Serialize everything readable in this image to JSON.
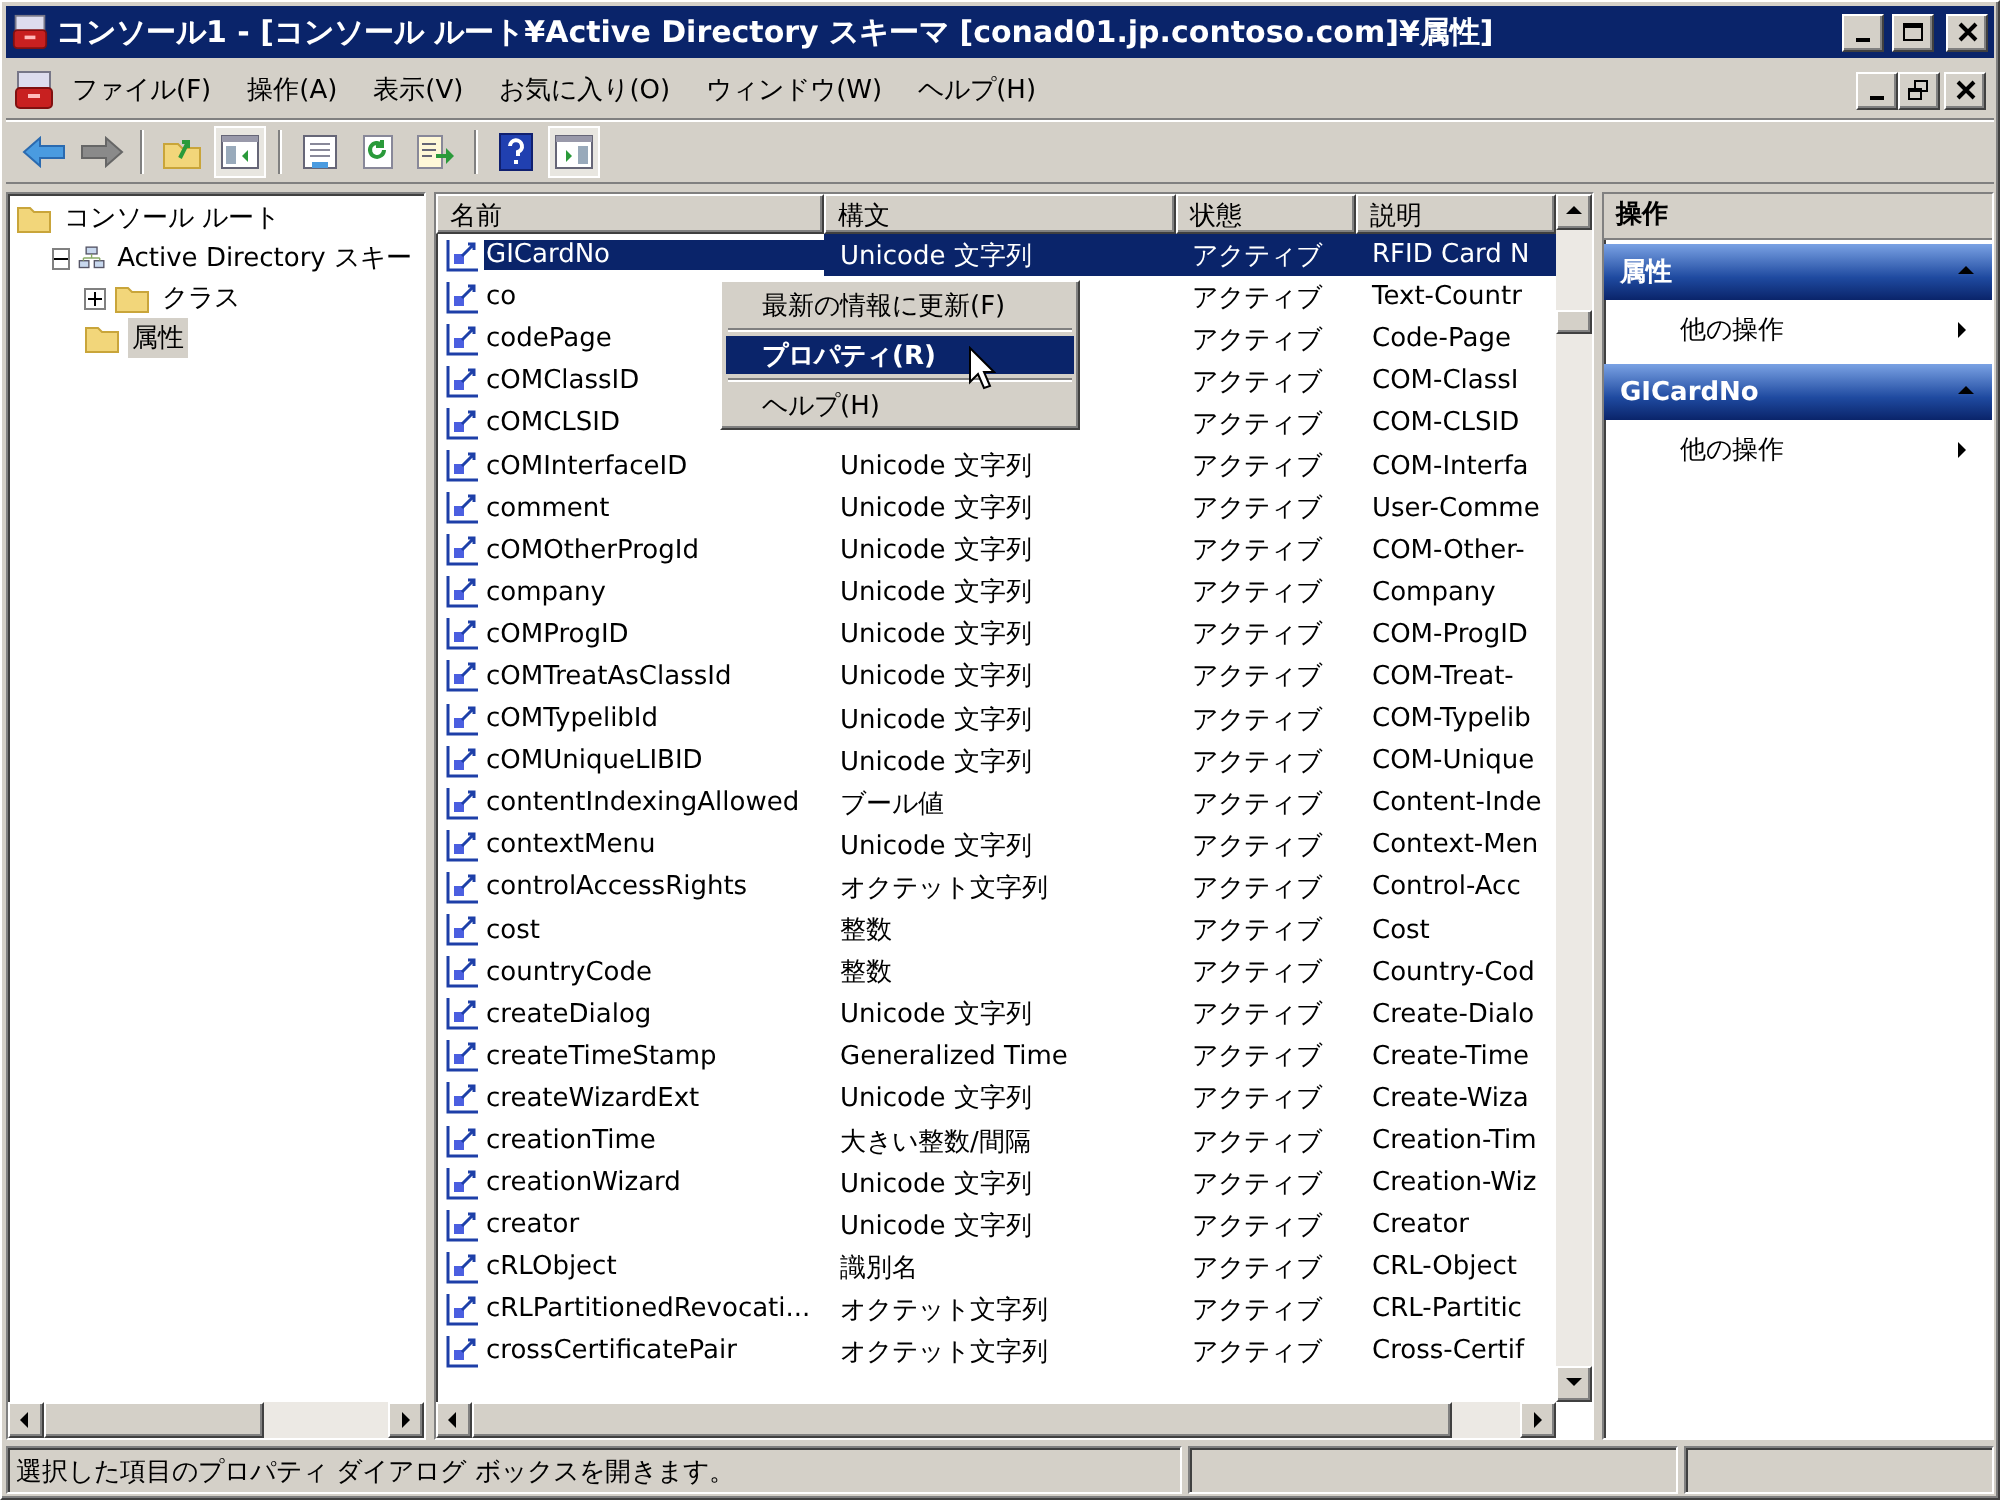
{
  "window": {
    "title": "コンソール1 - [コンソール ルート¥Active Directory スキーマ [conad01.jp.contoso.com]¥属性]"
  },
  "menu_bar": [
    "ファイル(F)",
    "操作(A)",
    "表示(V)",
    "お気に入り(O)",
    "ウィンドウ(W)",
    "ヘルプ(H)"
  ],
  "toolbar": [
    {
      "kind": "back",
      "pressed": false
    },
    {
      "kind": "forward",
      "pressed": false
    },
    {
      "kind": "separator"
    },
    {
      "kind": "up",
      "pressed": false
    },
    {
      "kind": "tree",
      "pressed": true
    },
    {
      "kind": "separator"
    },
    {
      "kind": "properties",
      "pressed": false
    },
    {
      "kind": "refresh",
      "pressed": false
    },
    {
      "kind": "export",
      "pressed": false
    },
    {
      "kind": "separator"
    },
    {
      "kind": "help",
      "pressed": false
    },
    {
      "kind": "actionpane",
      "pressed": true
    }
  ],
  "tree": [
    {
      "label": "コンソール ルート",
      "kind": "folder",
      "selected": false,
      "children": [
        {
          "label": "Active Directory スキー",
          "kind": "directory",
          "selected": false,
          "expanded": true,
          "children": [
            {
              "label": "クラス",
              "kind": "folder",
              "selected": false,
              "expanded": false
            },
            {
              "label": "属性",
              "kind": "folder",
              "selected": true
            }
          ]
        }
      ]
    }
  ],
  "table": {
    "columns": [
      "名前",
      "構文",
      "状態",
      "説明"
    ],
    "rows": [
      {
        "name": "GICardNo",
        "syntax": "Unicode 文字列",
        "status": "アクティブ",
        "description": "RFID Card N",
        "selected": true
      },
      {
        "name": "co",
        "status": "アクティブ",
        "description": "Text-Countr",
        "selected": false
      },
      {
        "name": "codePage",
        "status": "アクティブ",
        "description": "Code-Page",
        "selected": false
      },
      {
        "name": "cOMClassID",
        "status": "アクティブ",
        "description": "COM-ClassI",
        "selected": false
      },
      {
        "name": "cOMCLSID",
        "status": "アクティブ",
        "description": "COM-CLSID",
        "selected": false
      },
      {
        "name": "cOMInterfaceID",
        "syntax": "Unicode 文字列",
        "status": "アクティブ",
        "description": "COM-Interfa",
        "selected": false
      },
      {
        "name": "comment",
        "syntax": "Unicode 文字列",
        "status": "アクティブ",
        "description": "User-Comme",
        "selected": false
      },
      {
        "name": "cOMOtherProgId",
        "syntax": "Unicode 文字列",
        "status": "アクティブ",
        "description": "COM-Other-",
        "selected": false
      },
      {
        "name": "company",
        "syntax": "Unicode 文字列",
        "status": "アクティブ",
        "description": "Company",
        "selected": false
      },
      {
        "name": "cOMProgID",
        "syntax": "Unicode 文字列",
        "status": "アクティブ",
        "description": "COM-ProgID",
        "selected": false
      },
      {
        "name": "cOMTreatAsClassId",
        "syntax": "Unicode 文字列",
        "status": "アクティブ",
        "description": "COM-Treat-",
        "selected": false
      },
      {
        "name": "cOMTypelibId",
        "syntax": "Unicode 文字列",
        "status": "アクティブ",
        "description": "COM-Typelib",
        "selected": false
      },
      {
        "name": "cOMUniqueLIBID",
        "syntax": "Unicode 文字列",
        "status": "アクティブ",
        "description": "COM-Unique",
        "selected": false
      },
      {
        "name": "contentIndexingAllowed",
        "syntax": "ブール値",
        "status": "アクティブ",
        "description": "Content-Inde",
        "selected": false
      },
      {
        "name": "contextMenu",
        "syntax": "Unicode 文字列",
        "status": "アクティブ",
        "description": "Context-Men",
        "selected": false
      },
      {
        "name": "controlAccessRights",
        "syntax": "オクテット文字列",
        "status": "アクティブ",
        "description": "Control-Acc",
        "selected": false
      },
      {
        "name": "cost",
        "syntax": "整数",
        "status": "アクティブ",
        "description": "Cost",
        "selected": false
      },
      {
        "name": "countryCode",
        "syntax": "整数",
        "status": "アクティブ",
        "description": "Country-Cod",
        "selected": false
      },
      {
        "name": "createDialog",
        "syntax": "Unicode 文字列",
        "status": "アクティブ",
        "description": "Create-Dialo",
        "selected": false
      },
      {
        "name": "createTimeStamp",
        "syntax": "Generalized Time",
        "status": "アクティブ",
        "description": "Create-Time",
        "selected": false
      },
      {
        "name": "createWizardExt",
        "syntax": "Unicode 文字列",
        "status": "アクティブ",
        "description": "Create-Wiza",
        "selected": false
      },
      {
        "name": "creationTime",
        "syntax": "大きい整数/間隔",
        "status": "アクティブ",
        "description": "Creation-Tim",
        "selected": false
      },
      {
        "name": "creationWizard",
        "syntax": "Unicode 文字列",
        "status": "アクティブ",
        "description": "Creation-Wiz",
        "selected": false
      },
      {
        "name": "creator",
        "syntax": "Unicode 文字列",
        "status": "アクティブ",
        "description": "Creator",
        "selected": false
      },
      {
        "name": "cRLObject",
        "syntax": "識別名",
        "status": "アクティブ",
        "description": "CRL-Object",
        "selected": false
      },
      {
        "name": "cRLPartitionedRevocati...",
        "syntax": "オクテット文字列",
        "status": "アクティブ",
        "description": "CRL-Partitic",
        "selected": false
      },
      {
        "name": "crossCertificatePair",
        "syntax": "オクテット文字列",
        "status": "アクティブ",
        "description": "Cross-Certif",
        "selected": false
      }
    ]
  },
  "context_menu": [
    {
      "kind": "item",
      "label": "最新の情報に更新(F)",
      "selected": false
    },
    {
      "kind": "separator"
    },
    {
      "kind": "item",
      "label": "プロパティ(R)",
      "selected": true
    },
    {
      "kind": "separator"
    },
    {
      "kind": "item",
      "label": "ヘルプ(H)",
      "selected": false
    }
  ],
  "actions": {
    "title": "操作",
    "sections": [
      {
        "title": "属性",
        "expanded": true,
        "items": [
          "他の操作"
        ]
      },
      {
        "title": "GICardNo",
        "expanded": true,
        "items": [
          "他の操作"
        ]
      }
    ]
  },
  "status_bar": {
    "text": "選択した項目のプロパティ ダイアログ ボックスを開きます。"
  }
}
